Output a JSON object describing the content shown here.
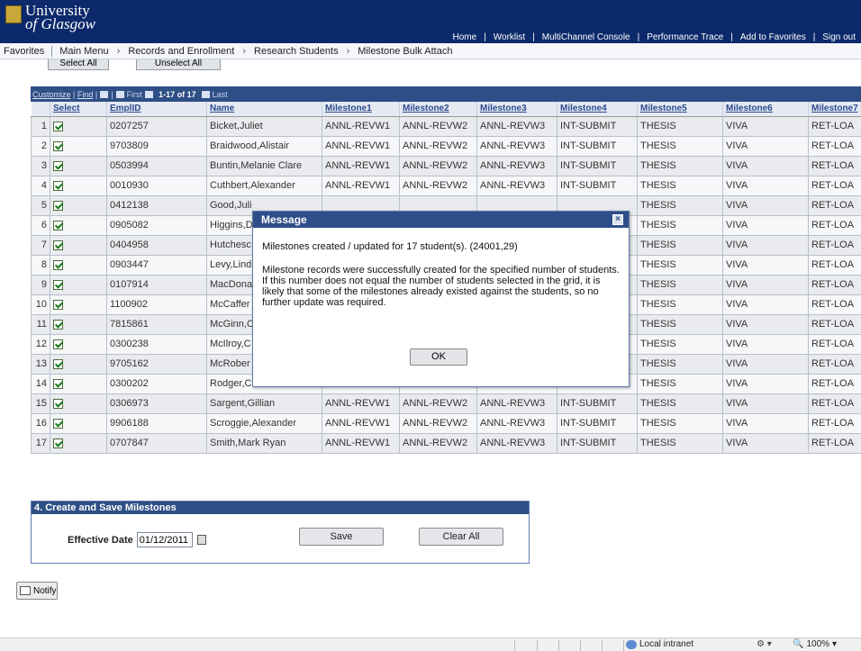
{
  "header": {
    "logo_line1": "University",
    "logo_line2": "of Glasgow",
    "links": [
      "Home",
      "Worklist",
      "MultiChannel Console",
      "Performance Trace",
      "Add to Favorites",
      "Sign out"
    ]
  },
  "nav": {
    "favorites": "Favorites",
    "main_menu": "Main Menu",
    "crumbs": [
      "Records and Enrollment",
      "Research Students",
      "Milestone Bulk Attach"
    ]
  },
  "buttons": {
    "select_all": "Select All",
    "unselect_all": "Unselect All"
  },
  "grid": {
    "customize": "Customize",
    "find": "Find",
    "first": "First",
    "range": "1-17 of 17",
    "last": "Last",
    "columns": [
      "",
      "Select",
      "EmplID",
      "Name",
      "Milestone1",
      "Milestone2",
      "Milestone3",
      "Milestone4",
      "Milestone5",
      "Milestone6",
      "Milestone7"
    ],
    "rows": [
      {
        "num": "1",
        "emplid": "0207257",
        "name": "Bicket,Juliet",
        "m1": "ANNL-REVW1",
        "m2": "ANNL-REVW2",
        "m3": "ANNL-REVW3",
        "m4": "INT-SUBMIT",
        "m5": "THESIS",
        "m6": "VIVA",
        "m7": "RET-LOA"
      },
      {
        "num": "2",
        "emplid": "9703809",
        "name": "Braidwood,Alistair",
        "m1": "ANNL-REVW1",
        "m2": "ANNL-REVW2",
        "m3": "ANNL-REVW3",
        "m4": "INT-SUBMIT",
        "m5": "THESIS",
        "m6": "VIVA",
        "m7": "RET-LOA"
      },
      {
        "num": "3",
        "emplid": "0503994",
        "name": "Buntin,Melanie Clare",
        "m1": "ANNL-REVW1",
        "m2": "ANNL-REVW2",
        "m3": "ANNL-REVW3",
        "m4": "INT-SUBMIT",
        "m5": "THESIS",
        "m6": "VIVA",
        "m7": "RET-LOA"
      },
      {
        "num": "4",
        "emplid": "0010930",
        "name": "Cuthbert,Alexander",
        "m1": "ANNL-REVW1",
        "m2": "ANNL-REVW2",
        "m3": "ANNL-REVW3",
        "m4": "INT-SUBMIT",
        "m5": "THESIS",
        "m6": "VIVA",
        "m7": "RET-LOA"
      },
      {
        "num": "5",
        "emplid": "0412138",
        "name": "Good,Juli",
        "m1": "",
        "m2": "",
        "m3": "",
        "m4": "",
        "m5": "THESIS",
        "m6": "VIVA",
        "m7": "RET-LOA"
      },
      {
        "num": "6",
        "emplid": "0905082",
        "name": "Higgins,D",
        "m1": "",
        "m2": "",
        "m3": "",
        "m4": "",
        "m5": "THESIS",
        "m6": "VIVA",
        "m7": "RET-LOA"
      },
      {
        "num": "7",
        "emplid": "0404958",
        "name": "Hutchesc",
        "m1": "",
        "m2": "",
        "m3": "",
        "m4": "",
        "m5": "THESIS",
        "m6": "VIVA",
        "m7": "RET-LOA"
      },
      {
        "num": "8",
        "emplid": "0903447",
        "name": "Levy,Lind",
        "m1": "",
        "m2": "",
        "m3": "",
        "m4": "",
        "m5": "THESIS",
        "m6": "VIVA",
        "m7": "RET-LOA"
      },
      {
        "num": "9",
        "emplid": "0107914",
        "name": "MacDona",
        "m1": "",
        "m2": "",
        "m3": "",
        "m4": "",
        "m5": "THESIS",
        "m6": "VIVA",
        "m7": "RET-LOA"
      },
      {
        "num": "10",
        "emplid": "1100902",
        "name": "McCaffer",
        "m1": "",
        "m2": "",
        "m3": "",
        "m4": "",
        "m5": "THESIS",
        "m6": "VIVA",
        "m7": "RET-LOA"
      },
      {
        "num": "11",
        "emplid": "7815861",
        "name": "McGinn,C",
        "m1": "",
        "m2": "",
        "m3": "",
        "m4": "",
        "m5": "THESIS",
        "m6": "VIVA",
        "m7": "RET-LOA"
      },
      {
        "num": "12",
        "emplid": "0300238",
        "name": "McIlroy,C",
        "m1": "",
        "m2": "",
        "m3": "",
        "m4": "",
        "m5": "THESIS",
        "m6": "VIVA",
        "m7": "RET-LOA"
      },
      {
        "num": "13",
        "emplid": "9705162",
        "name": "McRober",
        "m1": "",
        "m2": "",
        "m3": "",
        "m4": "",
        "m5": "THESIS",
        "m6": "VIVA",
        "m7": "RET-LOA"
      },
      {
        "num": "14",
        "emplid": "0300202",
        "name": "Rodger,Calum",
        "m1": "ANNL-REVW1",
        "m2": "ANNL-REVW2",
        "m3": "ANNL-REVW3",
        "m4": "INT-SUBMIT",
        "m5": "THESIS",
        "m6": "VIVA",
        "m7": "RET-LOA"
      },
      {
        "num": "15",
        "emplid": "0306973",
        "name": "Sargent,Gillian",
        "m1": "ANNL-REVW1",
        "m2": "ANNL-REVW2",
        "m3": "ANNL-REVW3",
        "m4": "INT-SUBMIT",
        "m5": "THESIS",
        "m6": "VIVA",
        "m7": "RET-LOA"
      },
      {
        "num": "16",
        "emplid": "9906188",
        "name": "Scroggie,Alexander",
        "m1": "ANNL-REVW1",
        "m2": "ANNL-REVW2",
        "m3": "ANNL-REVW3",
        "m4": "INT-SUBMIT",
        "m5": "THESIS",
        "m6": "VIVA",
        "m7": "RET-LOA"
      },
      {
        "num": "17",
        "emplid": "0707847",
        "name": "Smith,Mark Ryan",
        "m1": "ANNL-REVW1",
        "m2": "ANNL-REVW2",
        "m3": "ANNL-REVW3",
        "m4": "INT-SUBMIT",
        "m5": "THESIS",
        "m6": "VIVA",
        "m7": "RET-LOA"
      }
    ]
  },
  "section": {
    "title": "4. Create and Save Milestones",
    "effective_label": "Effective Date",
    "effective_value": "01/12/2011",
    "save": "Save",
    "clear_all": "Clear All"
  },
  "notify": "Notify",
  "dialog": {
    "title": "Message",
    "line1": "Milestones created / updated for 17 student(s). (24001,29)",
    "line2": "Milestone records were successfully created for the specified number of students. If this number does not equal the number of students selected in the grid, it is likely that some of the milestones already existed against the students, so no further update was required.",
    "ok": "OK"
  },
  "status": {
    "zone": "Local intranet",
    "zoom": "100%"
  }
}
